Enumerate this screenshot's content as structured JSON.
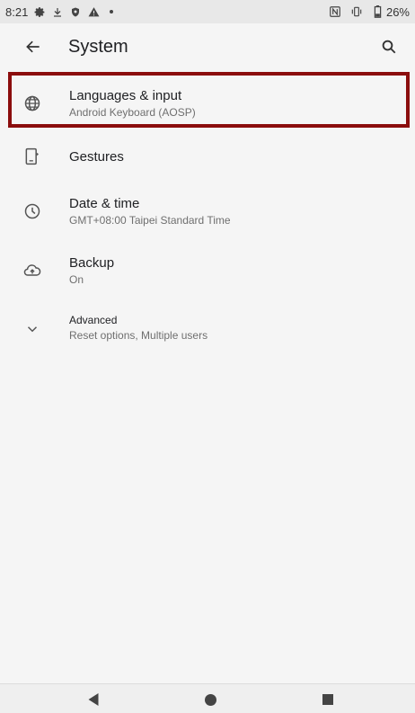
{
  "status_bar": {
    "time": "8:21",
    "battery": "26%",
    "left_icons": [
      "settings-gear-icon",
      "download-icon",
      "shield-icon",
      "warning-icon",
      "dot-icon"
    ],
    "right_icons": [
      "nfc-icon",
      "vibrate-icon",
      "battery-icon"
    ]
  },
  "app_bar": {
    "title": "System",
    "back_icon": "arrow-left-icon",
    "search_icon": "search-icon"
  },
  "items": [
    {
      "title": "Languages & input",
      "summary": "Android Keyboard (AOSP)",
      "icon": "globe-icon",
      "highlighted": true
    },
    {
      "title": "Gestures",
      "summary": "",
      "icon": "phone-gesture-icon"
    },
    {
      "title": "Date & time",
      "summary": "GMT+08:00 Taipei Standard Time",
      "icon": "clock-icon"
    },
    {
      "title": "Backup",
      "summary": "On",
      "icon": "cloud-upload-icon"
    },
    {
      "title": "Advanced",
      "summary": "Reset options, Multiple users",
      "icon": "chevron-down-icon"
    }
  ],
  "nav_bar": {
    "back": "back-triangle-icon",
    "home": "home-circle-icon",
    "recents": "recents-square-icon"
  },
  "colors": {
    "background": "#f5f5f5",
    "highlight_border": "#8b0d0d",
    "icon": "#555555",
    "secondary_text": "#6f6f6f"
  }
}
